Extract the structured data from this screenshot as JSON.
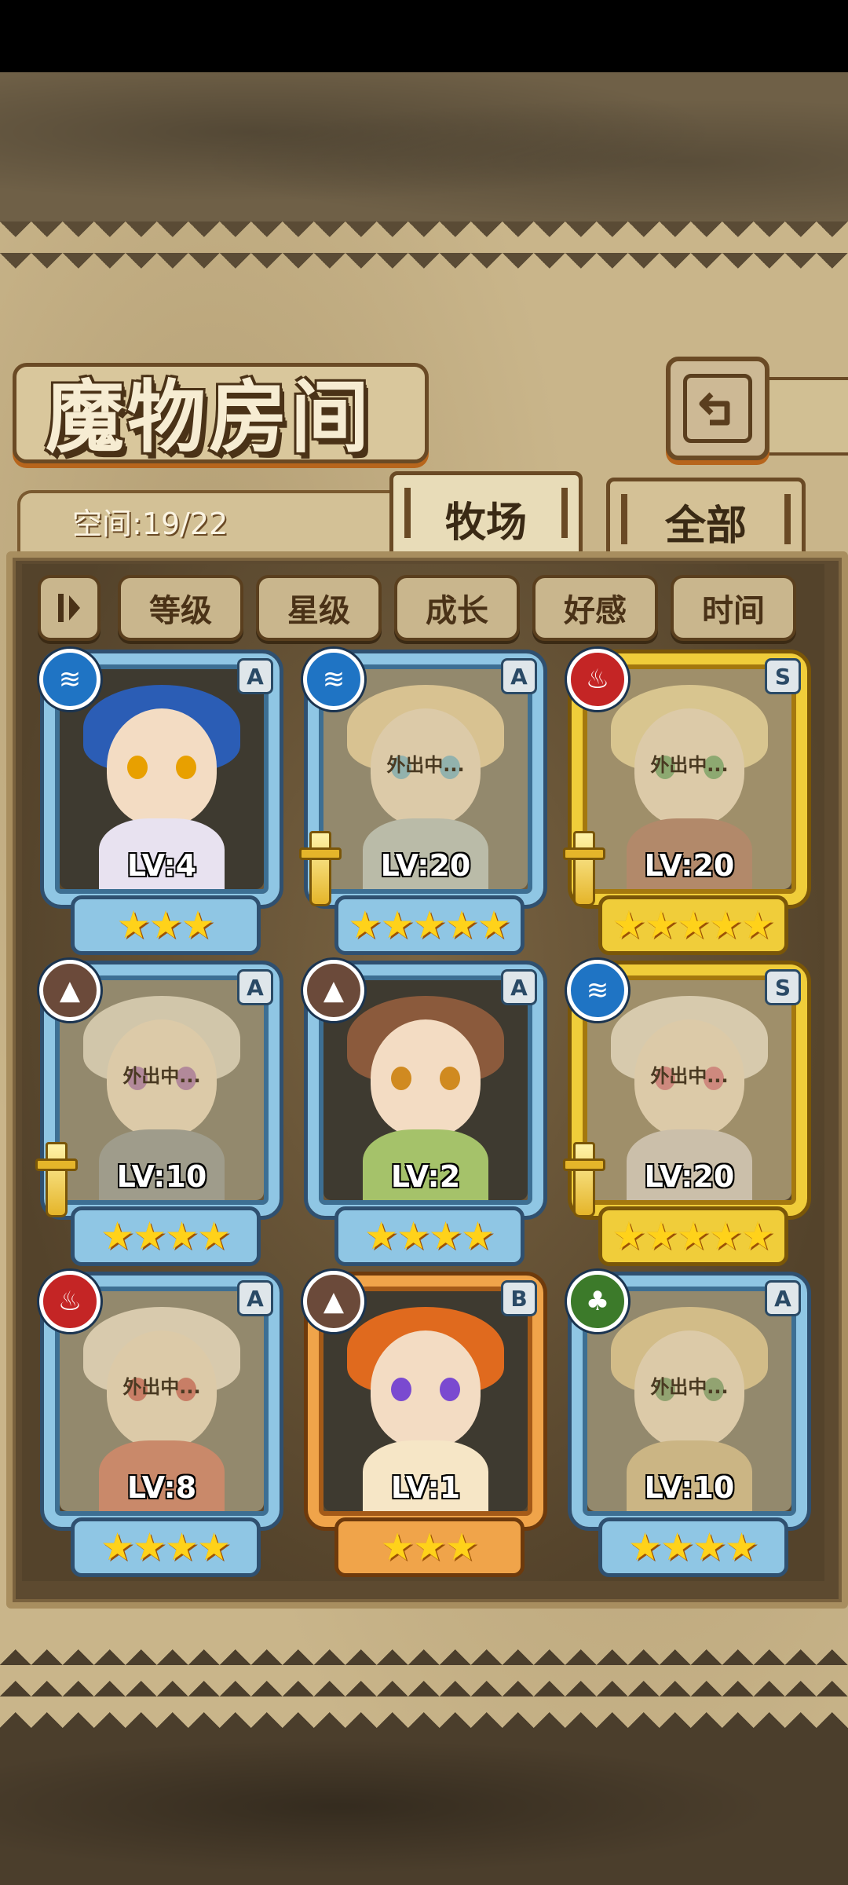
{
  "header": {
    "title": "魔物房间"
  },
  "tabs": {
    "space": "空间:19/22",
    "ranch": "牧场",
    "all": "全部"
  },
  "filters": {
    "sort_icon": "sort-icon",
    "level": "等级",
    "star": "星级",
    "growth": "成长",
    "affinity": "好感",
    "time": "时间"
  },
  "colors": {
    "frame_A": "#8fc6e4",
    "frame_S": "#f0cd3a",
    "frame_B": "#f0a44a",
    "parchment": "#c9b58a"
  },
  "cards": [
    {
      "element": "water",
      "rank": "A",
      "level": "LV:4",
      "stars": 3,
      "away": "",
      "equipped": false
    },
    {
      "element": "water",
      "rank": "A",
      "level": "LV:20",
      "stars": 5,
      "away": "外出中...",
      "equipped": true
    },
    {
      "element": "fire",
      "rank": "S",
      "level": "LV:20",
      "stars": 5,
      "away": "外出中...",
      "equipped": true
    },
    {
      "element": "earth",
      "rank": "A",
      "level": "LV:10",
      "stars": 4,
      "away": "外出中...",
      "equipped": true
    },
    {
      "element": "earth",
      "rank": "A",
      "level": "LV:2",
      "stars": 4,
      "away": "",
      "equipped": false
    },
    {
      "element": "water",
      "rank": "S",
      "level": "LV:20",
      "stars": 5,
      "away": "外出中...",
      "equipped": true
    },
    {
      "element": "fire",
      "rank": "A",
      "level": "LV:8",
      "stars": 4,
      "away": "外出中...",
      "equipped": false
    },
    {
      "element": "earth",
      "rank": "B",
      "level": "LV:1",
      "stars": 3,
      "away": "",
      "equipped": false
    },
    {
      "element": "wood",
      "rank": "A",
      "level": "LV:10",
      "stars": 4,
      "away": "外出中...",
      "equipped": false
    }
  ]
}
